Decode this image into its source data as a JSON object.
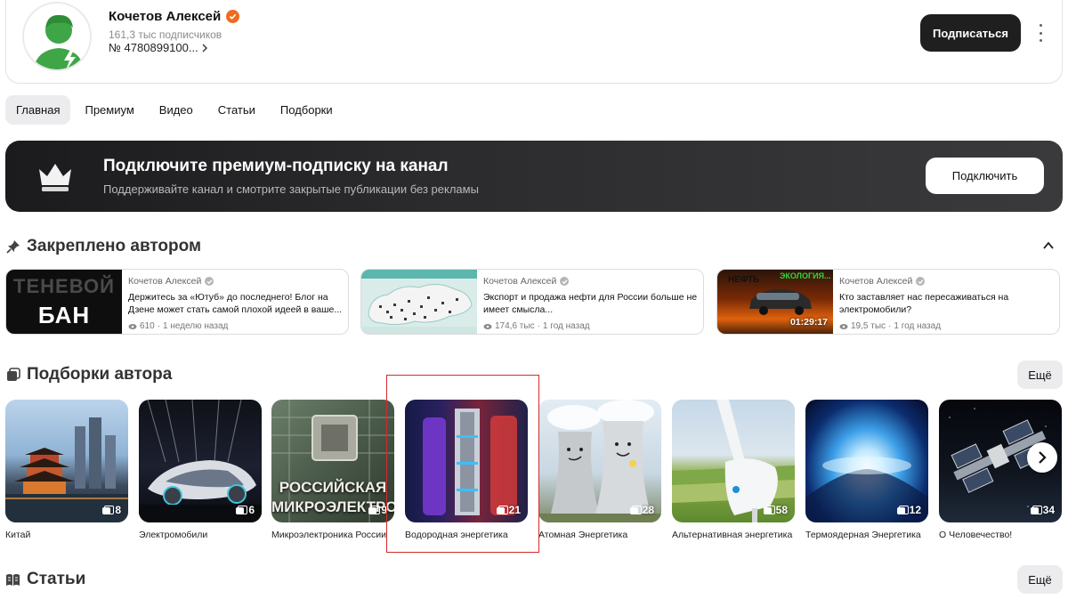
{
  "channel": {
    "name": "Кочетов Алексей",
    "subscribers": "161,3 тыс подписчиков",
    "number": "№ 4780899100...",
    "subscribe_label": "Подписаться"
  },
  "tabs": [
    {
      "label": "Главная",
      "active": true
    },
    {
      "label": "Премиум",
      "active": false
    },
    {
      "label": "Видео",
      "active": false
    },
    {
      "label": "Статьи",
      "active": false
    },
    {
      "label": "Подборки",
      "active": false
    }
  ],
  "premium": {
    "title": "Подключите премиум-подписку на канал",
    "subtitle": "Поддерживайте канал и смотрите закрытые публикации без рекламы",
    "button_label": "Подключить"
  },
  "pinned": {
    "title": "Закреплено автором",
    "items": [
      {
        "author": "Кочетов Алексей",
        "title": "Держитесь за «Ютуб» до последнего! Блог на Дзене может стать самой плохой идеей в ваше...",
        "views": "610",
        "age": "1 неделю назад",
        "thumb_line1": "ТЕНЕВОЙ",
        "thumb_line2": "БАН"
      },
      {
        "author": "Кочетов Алексей",
        "title": "Экспорт и продажа нефти для России больше не имеет смысла...",
        "views": "174,6 тыс",
        "age": "1 год назад"
      },
      {
        "author": "Кочетов Алексей",
        "title": "Кто заставляет нас пересаживаться на электромобили?",
        "views": "19,5 тыс",
        "age": "1 год назад",
        "duration": "01:29:17",
        "thumb_line1": "НЕФТЬ",
        "thumb_line2": "ЭКОЛОГИЯ..."
      }
    ]
  },
  "collections": {
    "title": "Подборки автора",
    "more_label": "Ещё",
    "items": [
      {
        "label": "Китай",
        "count": "8"
      },
      {
        "label": "Электромобили",
        "count": "6"
      },
      {
        "label": "Микроэлектроника России",
        "count": "9",
        "thumb_text": "РОССИЙСКАЯ МИКРОЭЛЕКТРОНИКА"
      },
      {
        "label": "Водородная энергетика",
        "count": "21"
      },
      {
        "label": "Атомная Энергетика",
        "count": "28"
      },
      {
        "label": "Альтернативная энергетика",
        "count": "58"
      },
      {
        "label": "Термоядерная Энергетика",
        "count": "12"
      },
      {
        "label": "О Человечество!",
        "count": "34"
      }
    ]
  },
  "articles": {
    "title": "Статьи",
    "more_label": "Ещё"
  },
  "colors": {
    "accent_badge": "#f06a1e",
    "highlight": "#d42a2a",
    "dark_button": "#1f1f1f"
  }
}
